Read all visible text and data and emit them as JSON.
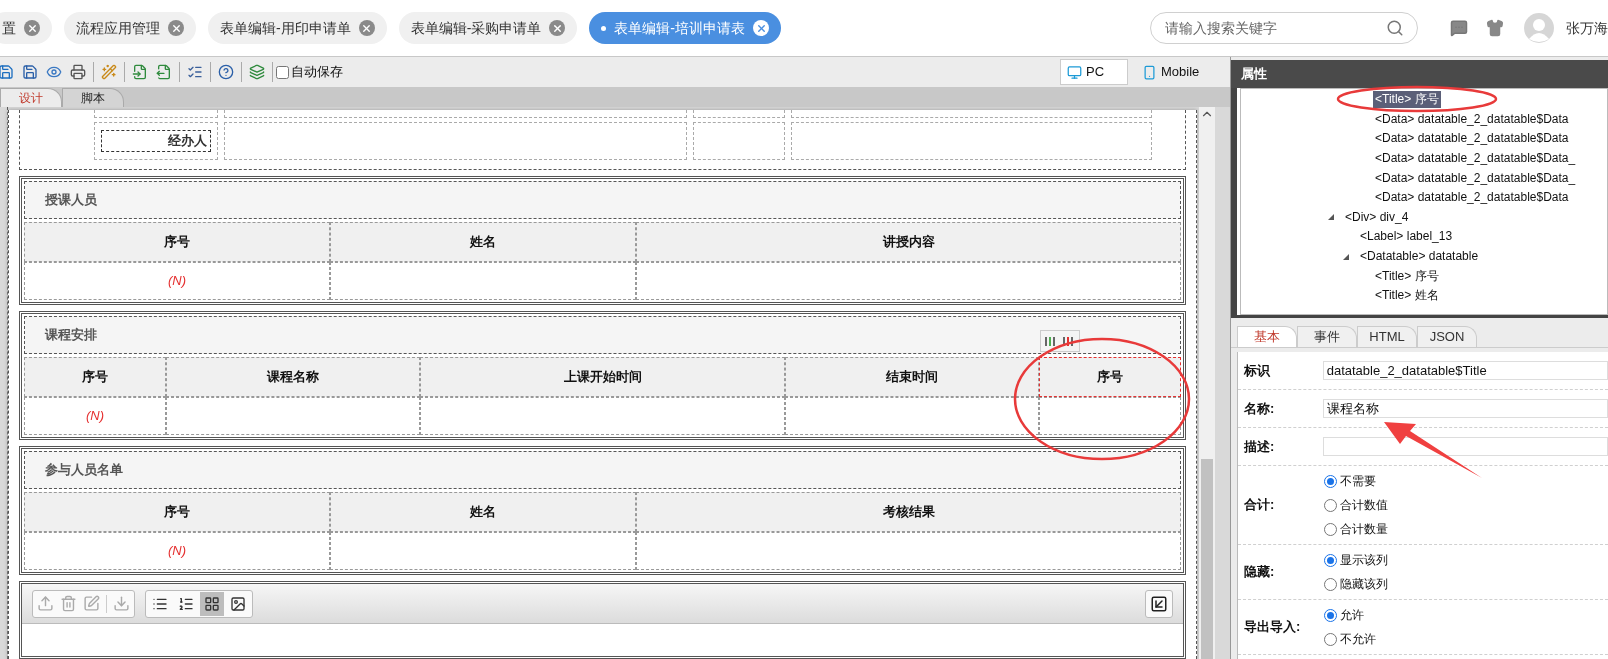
{
  "tabs": [
    {
      "label": "置",
      "selected": false
    },
    {
      "label": "流程应用管理",
      "selected": false
    },
    {
      "label": "表单编辑-用印申请单",
      "selected": false
    },
    {
      "label": "表单编辑-采购申请单",
      "selected": false
    },
    {
      "label": "表单编辑-培训申请表",
      "selected": true
    }
  ],
  "search": {
    "placeholder": "请输入搜索关键字"
  },
  "user": {
    "name": "张万海"
  },
  "toolbar": {
    "autosave": {
      "label": "自动保存",
      "checked": false
    }
  },
  "view_modes": [
    {
      "label": "PC",
      "selected": true
    },
    {
      "label": "Mobile",
      "selected": false
    }
  ],
  "editor_tabs": [
    {
      "label": "设计",
      "selected": true
    },
    {
      "label": "脚本",
      "selected": false
    }
  ],
  "form": {
    "top_label": "经办人",
    "sections": [
      {
        "title": "授课人员",
        "index_cell": "(N)",
        "columns": [
          {
            "label": "序号",
            "selected": false
          },
          {
            "label": "姓名",
            "selected": false
          },
          {
            "label": "讲授内容",
            "selected": false
          }
        ]
      },
      {
        "title": "课程安排",
        "index_cell": "(N)",
        "columns": [
          {
            "label": "序号",
            "selected": false
          },
          {
            "label": "课程名称",
            "selected": false
          },
          {
            "label": "上课开始时间",
            "selected": false
          },
          {
            "label": "结束时间",
            "selected": false
          },
          {
            "label": "序号",
            "selected": true
          }
        ]
      },
      {
        "title": "参与人员名单",
        "index_cell": "(N)",
        "columns": [
          {
            "label": "序号",
            "selected": false
          },
          {
            "label": "姓名",
            "selected": false
          },
          {
            "label": "考核结果",
            "selected": false
          }
        ]
      }
    ],
    "attachment": {
      "views": [
        {
          "kind": "bullets",
          "selected": false
        },
        {
          "kind": "numbers",
          "selected": false
        },
        {
          "kind": "grid",
          "selected": true
        },
        {
          "kind": "image",
          "selected": false
        }
      ]
    }
  },
  "properties": {
    "title": "属性",
    "tree": [
      {
        "children": [
          {
            "children": [
              {
                "label": "<Title> 序号",
                "selected": true
              },
              {
                "label": "<Data> datatable_2_datatable$Data",
                "selected": false
              },
              {
                "label": "<Data> datatable_2_datatable$Data",
                "selected": false
              },
              {
                "label": "<Data> datatable_2_datatable$Data_",
                "selected": false
              },
              {
                "label": "<Data> datatable_2_datatable$Data_",
                "selected": false
              },
              {
                "label": "<Data> datatable_2_datatable$Data",
                "selected": false
              }
            ]
          }
        ]
      },
      {
        "label": "<Div> div_4",
        "selected": false,
        "expanded": true,
        "children": [
          {
            "label": "<Label> label_13",
            "selected": false
          },
          {
            "label": "<Datatable> datatable",
            "selected": false,
            "expanded": true,
            "children": [
              {
                "label": "<Title> 序号",
                "selected": false
              },
              {
                "label": "<Title> 姓名",
                "selected": false
              }
            ]
          }
        ]
      }
    ],
    "tabs": [
      {
        "label": "基本",
        "selected": true
      },
      {
        "label": "事件",
        "selected": false
      },
      {
        "label": "HTML",
        "selected": false
      },
      {
        "label": "JSON",
        "selected": false
      }
    ],
    "fields": [
      {
        "kind": "text",
        "label": "标识",
        "value": "datatable_2_datatable$Title"
      },
      {
        "kind": "text",
        "label": "名称:",
        "value": "课程名称"
      },
      {
        "kind": "text",
        "label": "描述:"
      },
      {
        "kind": "radio",
        "label": "合计:",
        "options": [
          {
            "label": "不需要",
            "selected": true
          },
          {
            "label": "合计数值",
            "selected": false
          },
          {
            "label": "合计数量",
            "selected": false
          }
        ]
      },
      {
        "kind": "radio",
        "label": "隐藏:",
        "options": [
          {
            "label": "显示该列",
            "selected": true
          },
          {
            "label": "隐藏该列",
            "selected": false
          }
        ]
      },
      {
        "kind": "radio",
        "label": "导出导入:",
        "options": [
          {
            "label": "允许",
            "selected": true
          },
          {
            "label": "不允许",
            "selected": false
          }
        ]
      }
    ]
  }
}
